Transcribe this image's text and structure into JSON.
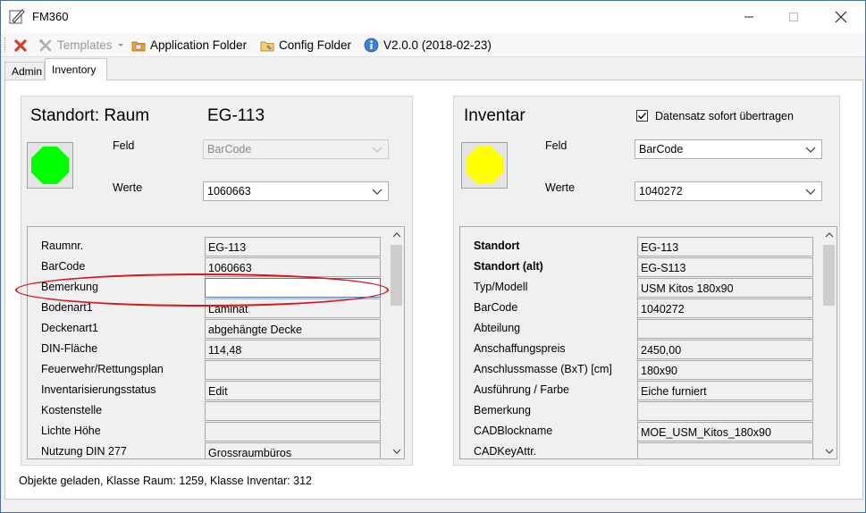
{
  "window": {
    "title": "FM360"
  },
  "toolbar": {
    "delete_label": "",
    "templates_label": "Templates",
    "application_folder_label": "Application Folder",
    "config_folder_label": "Config Folder",
    "version_label": "V2.0.0 (2018-02-23)"
  },
  "tabs": [
    {
      "label": "Admin"
    },
    {
      "label": "Inventory"
    }
  ],
  "left_panel": {
    "title": "Standort: Raum",
    "subtitle": "EG-113",
    "status_color": "#00ff00",
    "feld_label": "Feld",
    "feld_value": "BarCode",
    "werte_label": "Werte",
    "werte_value": "1060663",
    "rows": [
      {
        "label": "Raumnr.",
        "value": "EG-113"
      },
      {
        "label": "BarCode",
        "value": "1060663"
      },
      {
        "label": "Bemerkung",
        "value": ""
      },
      {
        "label": "Bodenart1",
        "value": "Laminat"
      },
      {
        "label": "Deckenart1",
        "value": "abgehängte Decke"
      },
      {
        "label": "DIN-Fläche",
        "value": "114,48"
      },
      {
        "label": "Feuerwehr/Rettungsplan",
        "value": ""
      },
      {
        "label": "Inventarisierungsstatus",
        "value": "Edit"
      },
      {
        "label": "Kostenstelle",
        "value": ""
      },
      {
        "label": "Lichte Höhe",
        "value": ""
      },
      {
        "label": "Nutzung DIN 277",
        "value": "Grossraumbüros"
      }
    ]
  },
  "right_panel": {
    "title": "Inventar",
    "checkbox_label": "Datensatz sofort übertragen",
    "checkbox_checked": true,
    "status_color": "#ffff00",
    "feld_label": "Feld",
    "feld_value": "BarCode",
    "werte_label": "Werte",
    "werte_value": "1040272",
    "rows": [
      {
        "label": "Standort",
        "value": "EG-113",
        "bold": true
      },
      {
        "label": "Standort (alt)",
        "value": "EG-S113",
        "bold": true
      },
      {
        "label": "Typ/Modell",
        "value": "USM Kitos 180x90"
      },
      {
        "label": "BarCode",
        "value": "1040272"
      },
      {
        "label": "Abteilung",
        "value": ""
      },
      {
        "label": "Anschaffungspreis",
        "value": "2450,00"
      },
      {
        "label": "Anschlussmasse (BxT) [cm]",
        "value": "180x90"
      },
      {
        "label": "Ausführung / Farbe",
        "value": "Eiche furniert"
      },
      {
        "label": "Bemerkung",
        "value": ""
      },
      {
        "label": "CADBlockname",
        "value": "MOE_USM_Kitos_180x90"
      },
      {
        "label": "CADKeyAttr.",
        "value": ""
      }
    ]
  },
  "status_bar": {
    "text": "Objekte geladen, Klasse Raum: 1259, Klasse Inventar: 312"
  },
  "highlight_color": "#d9141c"
}
